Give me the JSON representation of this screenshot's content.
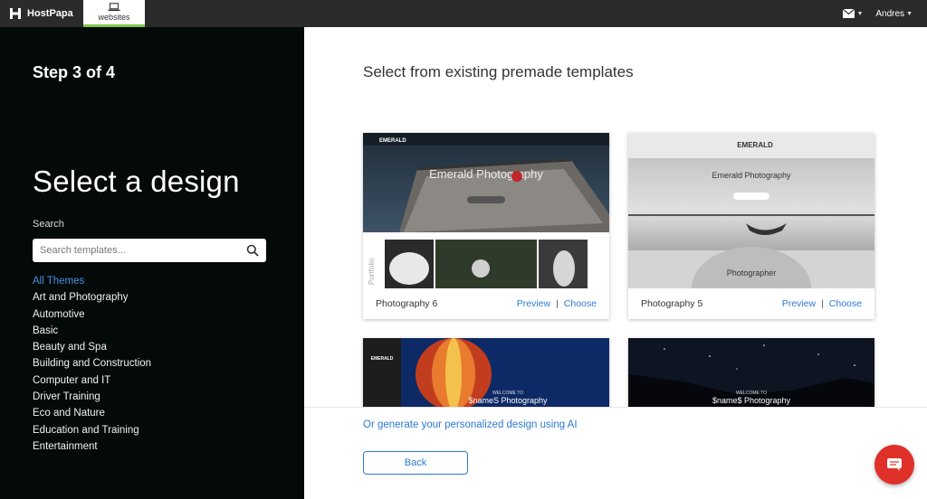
{
  "topbar": {
    "brand": "HostPapa",
    "tab_label": "websites",
    "user_name": "Andres"
  },
  "sidebar": {
    "step": "Step 3 of 4",
    "heading": "Select a design",
    "search_label": "Search",
    "search_placeholder": "Search templates...",
    "themes": [
      "All Themes",
      "Art and Photography",
      "Automotive",
      "Basic",
      "Beauty and Spa",
      "Building and Construction",
      "Computer and IT",
      "Driver Training",
      "Eco and Nature",
      "Education and Training",
      "Entertainment"
    ]
  },
  "main": {
    "title": "Select from existing premade templates",
    "cards": [
      {
        "name": "Photography 6",
        "preview": "Preview",
        "choose": "Choose",
        "img_title": "Emerald Photography",
        "side_label": "Portfolio",
        "brand": "EMERALD"
      },
      {
        "name": "Photography 5",
        "preview": "Preview",
        "choose": "Choose",
        "img_title": "Emerald Photography",
        "img_sub": "Photographer",
        "brand": "EMERALD"
      },
      {
        "img_title": "$nameS Photography",
        "img_pre": "WELCOME TO",
        "brand": "EMERALD"
      },
      {
        "img_title": "$name$ Photography",
        "img_pre": "WELCOME TO"
      }
    ],
    "ai_link": "Or generate your personalized design using AI",
    "back_label": "Back"
  },
  "colors": {
    "sidebar_bg": "#040a08",
    "accent_link": "#2a7ad5",
    "active_theme": "#4a90e2",
    "chat_button": "#e0302a",
    "tab_underline": "#7ec94a"
  }
}
